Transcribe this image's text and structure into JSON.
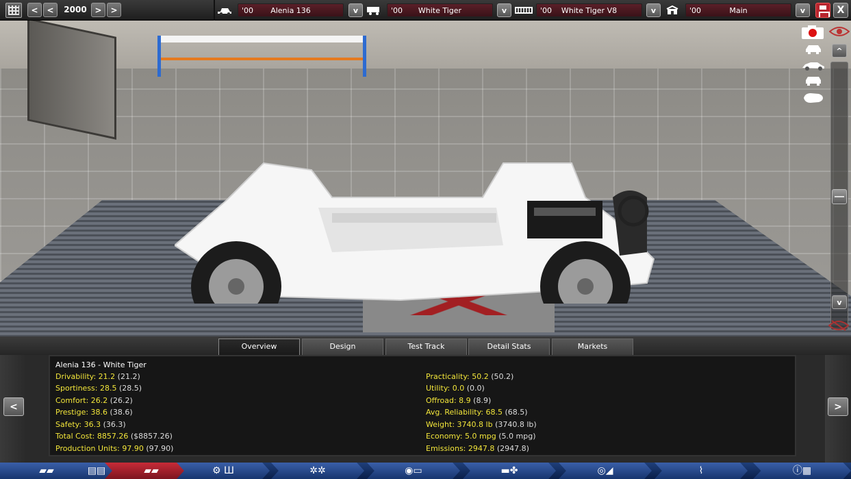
{
  "topbar": {
    "year": "2000",
    "prev_label": "<",
    "prev2_label": "<",
    "next_label": ">",
    "next2_label": ">",
    "selectors": [
      {
        "icon": "car-model-icon",
        "year": "'00",
        "name": "Alenia 136"
      },
      {
        "icon": "trim-icon",
        "year": "'00",
        "name": "White Tiger"
      },
      {
        "icon": "engine-icon",
        "year": "'00",
        "name": "White Tiger V8"
      },
      {
        "icon": "factory-icon",
        "year": "'00",
        "name": "Main"
      }
    ],
    "dropdown_label": "v",
    "close_label": "X"
  },
  "view_controls": {
    "up_label": "^",
    "down_label": "v"
  },
  "tabs": [
    "Overview",
    "Design",
    "Test Track",
    "Detail Stats",
    "Markets"
  ],
  "active_tab": "Overview",
  "stats": {
    "title": "Alenia 136 - White Tiger",
    "left": [
      {
        "label": "Drivability: 21.2",
        "orig": "(21.2)"
      },
      {
        "label": "Sportiness: 28.5",
        "orig": "(28.5)"
      },
      {
        "label": "Comfort: 26.2",
        "orig": "(26.2)"
      },
      {
        "label": "Prestige: 38.6",
        "orig": "(38.6)"
      },
      {
        "label": "Safety: 36.3",
        "orig": "(36.3)"
      },
      {
        "label": "Total Cost: 8857.26",
        "orig": "($8857.26)"
      },
      {
        "label": "Production Units: 97.90",
        "orig": "(97.90)"
      }
    ],
    "right": [
      {
        "label": "Practicality: 50.2",
        "orig": "(50.2)"
      },
      {
        "label": "Utility: 0.0",
        "orig": "(0.0)"
      },
      {
        "label": "Offroad: 8.9",
        "orig": "(8.9)"
      },
      {
        "label": "Avg. Reliability: 68.5",
        "orig": "(68.5)"
      },
      {
        "label": "Weight: 3740.8 lb",
        "orig": "(3740.8 lb)"
      },
      {
        "label": "Economy: 5.0 mpg",
        "orig": "(5.0 mpg)"
      },
      {
        "label": "Emissions: 2947.8",
        "orig": "(2947.8)"
      }
    ]
  },
  "panel_nav": {
    "prev_label": "<",
    "next_label": ">"
  },
  "bottom_nav": [
    {
      "icon": "car-model-icon",
      "glyph": "▰▰"
    },
    {
      "icon": "chassis-icon",
      "glyph": "▤▤"
    },
    {
      "icon": "trim-icon",
      "glyph": "▰▰",
      "active": true
    },
    {
      "icon": "gearbox-icon",
      "glyph": "⚙ Ш"
    },
    {
      "icon": "wheels-icon",
      "glyph": "✲✲"
    },
    {
      "icon": "brakes-icon",
      "glyph": "◉▭"
    },
    {
      "icon": "body-icon",
      "glyph": "▬✤"
    },
    {
      "icon": "interior-icon",
      "glyph": "◎◢"
    },
    {
      "icon": "suspension-icon",
      "glyph": "⌇"
    },
    {
      "icon": "finish-icon",
      "glyph": "ⓘ▦"
    }
  ],
  "colors": {
    "accent_red": "#b8252e",
    "stat_label": "#f2e53a",
    "nav_blue": "#17356e",
    "chassis": "#ffffff"
  }
}
